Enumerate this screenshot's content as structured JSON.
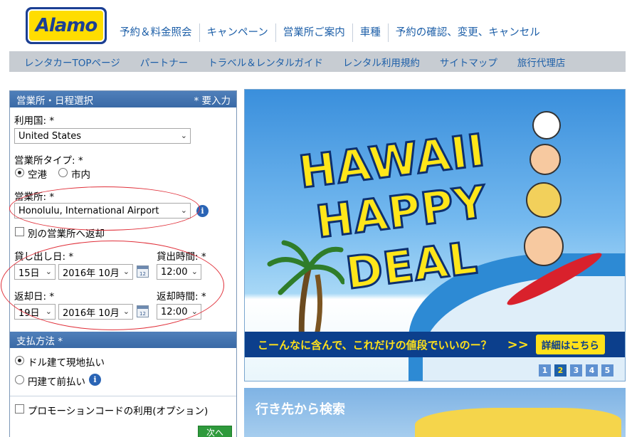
{
  "brand": {
    "logo_text": "Alamo"
  },
  "top_nav": [
    "予約＆料金照会",
    "キャンペーン",
    "営業所ご案内",
    "車種",
    "予約の確認、変更、キャンセル"
  ],
  "sub_nav": [
    "レンタカーTOPページ",
    "パートナー",
    "トラベル＆レンタルガイド",
    "レンタル利用規約",
    "サイトマップ",
    "旅行代理店"
  ],
  "booking": {
    "header": "営業所・日程選択",
    "required_note": "* 要入力",
    "country_label": "利用国: *",
    "country_value": "United States",
    "location_type_label": "営業所タイプ: *",
    "location_type_options": [
      "空港",
      "市内"
    ],
    "location_label": "営業所: *",
    "location_value": "Honolulu, International Airport",
    "return_other_label": "別の営業所へ返却",
    "pickup_date_label": "貸し出し日: *",
    "pickup_time_label": "貸出時間: *",
    "pickup_day": "15日",
    "pickup_month": "2016年 10月",
    "pickup_time": "12:00",
    "return_date_label": "返却日: *",
    "return_time_label": "返却時間: *",
    "return_day": "19日",
    "return_month": "2016年 10月",
    "return_time": "12:00",
    "payment_header": "支払方法 *",
    "payment_options": [
      "ドル建て現地払い",
      "円建て前払い"
    ],
    "promo_label": "プロモーションコードの利用(オプション)",
    "next_button": "次へ"
  },
  "banner": {
    "headline": [
      "HAWAII",
      "HAPPY",
      "DEAL"
    ],
    "strip_text": "こーんなに含んで、これだけの値段でいいのー？",
    "strip_arrow": ">>",
    "details_button": "詳細はこちら",
    "pages": [
      "1",
      "2",
      "3",
      "4",
      "5"
    ],
    "active_page": "2"
  },
  "destination_search": {
    "title": "行き先から検索"
  },
  "colors": {
    "brand_blue": "#1b3f93",
    "brand_yellow": "#ffdd00",
    "panel_header": "#3a6aa6",
    "highlight_oval": "#e0303a",
    "link": "#1d5fa8"
  }
}
